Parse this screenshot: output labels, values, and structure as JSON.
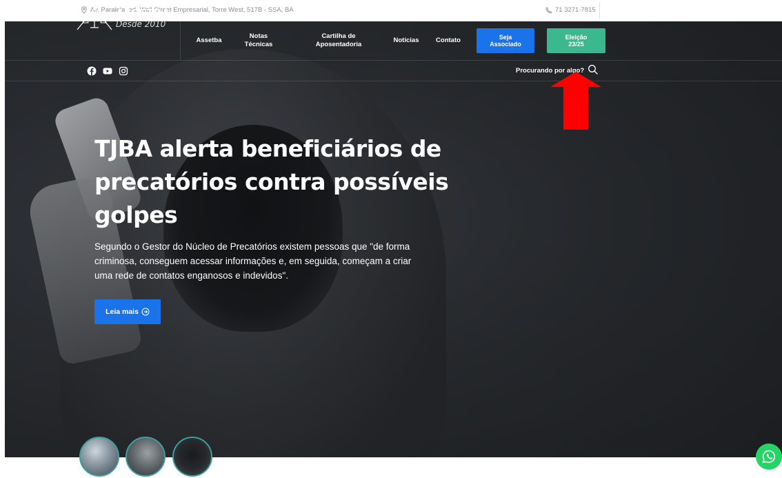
{
  "topbar": {
    "address": "Av. Paralela, ed. Wall Street Empresarial, Torre West, 517B - SSA, BA",
    "phone": "71 3271-7815"
  },
  "header": {
    "logo_name": "ASSETBA",
    "logo_tagline": "Desde 2010",
    "menu": [
      {
        "label": "Assetba"
      },
      {
        "label": "Notas\nTécnicas"
      },
      {
        "label": "Cartilha de\nAposentadoria"
      },
      {
        "label": "Notícias"
      },
      {
        "label": "Contato"
      }
    ],
    "cta_associate": "Seja\nAssociado",
    "cta_election": "Eleição\n23/25"
  },
  "subbar": {
    "social_icons": [
      "facebook-icon",
      "youtube-icon",
      "instagram-icon"
    ],
    "search_placeholder": "Procurando por algo?"
  },
  "hero": {
    "title": "TJBA alerta beneficiários de precatórios contra possíveis golpes",
    "description": "Segundo o Gestor do Núcleo de Precatórios existem pessoas que \"de forma criminosa, conseguem acessar informações e, em seguida, começam a criar uma rede de contatos enganosos e indevidos\".",
    "read_more": "Leia mais"
  },
  "colors": {
    "accent_blue": "#1a73e8",
    "accent_green": "#3cb88f",
    "annotation_arrow": "#ff0000",
    "whatsapp": "#25d366"
  }
}
